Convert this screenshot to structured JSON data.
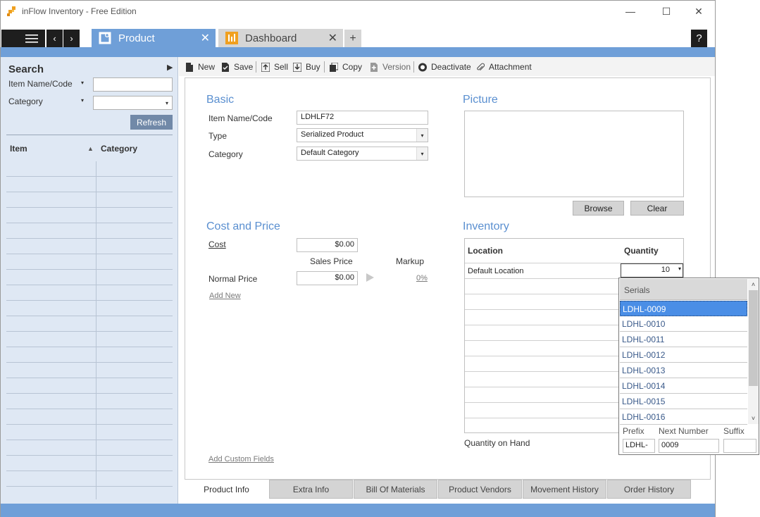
{
  "window": {
    "title": "inFlow Inventory - Free Edition",
    "minimize": "—",
    "maximize": "☐",
    "close": "✕"
  },
  "tabs": [
    {
      "label": "Product",
      "close": "✕"
    },
    {
      "label": "Dashboard",
      "close": "✕"
    }
  ],
  "tab_add": "+",
  "help": "?",
  "nav": {
    "back": "‹",
    "forward": "›"
  },
  "search": {
    "title": "Search",
    "name_label": "Item Name/Code",
    "category_label": "Category",
    "refresh": "Refresh",
    "columns": [
      "Item",
      "Category"
    ],
    "caret": "▾",
    "expand": "▶",
    "sort": "▲"
  },
  "toolbar": {
    "new": "New",
    "save": "Save",
    "sell": "Sell",
    "buy": "Buy",
    "copy": "Copy",
    "version": "Version",
    "deactivate": "Deactivate",
    "attachment": "Attachment"
  },
  "basic": {
    "title": "Basic",
    "name_label": "Item Name/Code",
    "name_value": "LDHLF72",
    "type_label": "Type",
    "type_value": "Serialized Product",
    "category_label": "Category",
    "category_value": "Default Category"
  },
  "picture": {
    "title": "Picture",
    "browse": "Browse",
    "clear": "Clear"
  },
  "pricing": {
    "title": "Cost and Price",
    "cost_label": "Cost",
    "cost_value": "$0.00",
    "sales_price_header": "Sales Price",
    "markup_header": "Markup",
    "normal_price_label": "Normal Price",
    "normal_price_value": "$0.00",
    "markup_value": "0%",
    "add_new": "Add New"
  },
  "inventory": {
    "title": "Inventory",
    "location_header": "Location",
    "quantity_header": "Quantity",
    "location_value": "Default Location",
    "quantity_value": "10",
    "quantity_on_hand_label": "Quantity on Hand"
  },
  "serials": {
    "header": "Serials",
    "items": [
      "LDHL-0009",
      "LDHL-0010",
      "LDHL-0011",
      "LDHL-0012",
      "LDHL-0013",
      "LDHL-0014",
      "LDHL-0015",
      "LDHL-0016"
    ],
    "prefix_label": "Prefix",
    "next_number_label": "Next Number",
    "suffix_label": "Suffix",
    "prefix_value": "LDHL-",
    "next_number_value": "0009",
    "suffix_value": ""
  },
  "add_custom_fields": "Add Custom Fields",
  "bottom_tabs": [
    "Product Info",
    "Extra Info",
    "Bill Of Materials",
    "Product Vendors",
    "Movement History",
    "Order History"
  ],
  "colors": {
    "accent": "#6f9fd8",
    "section_title": "#5a8fd0",
    "selected_row": "#4a8ee6"
  }
}
